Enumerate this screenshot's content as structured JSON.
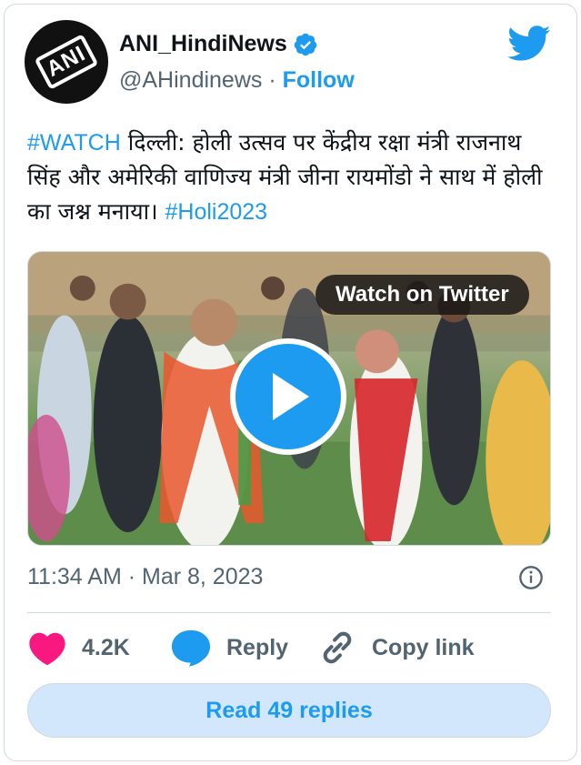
{
  "author": {
    "display_name": "ANI_HindiNews",
    "handle": "@AHindinews",
    "separator": "·",
    "follow_label": "Follow",
    "avatar_text": "ANI",
    "verified": true
  },
  "tweet": {
    "hashtag_watch": "#WATCH",
    "body": "  दिल्ली: होली उत्सव पर केंद्रीय रक्षा मंत्री राजनाथ सिंह और अमेरिकी वाणिज्य मंत्री जीना रायमोंडो ने साथ में होली का जश्न मनाया। ",
    "hashtag_holi": "#Holi2023"
  },
  "media": {
    "watch_label": "Watch on Twitter"
  },
  "meta": {
    "timestamp": "11:34 AM · Mar 8, 2023"
  },
  "actions": {
    "likes_count": "4.2K",
    "reply_label": "Reply",
    "copy_link_label": "Copy link"
  },
  "footer": {
    "read_replies_label": "Read 49 replies"
  },
  "colors": {
    "accent": "#1d9bf0",
    "like": "#f91880",
    "muted_text": "#536471",
    "border": "#cfd9de",
    "button_bg": "#d2e7fb"
  },
  "icons": [
    "verified-badge-icon",
    "twitter-bird-icon",
    "play-icon",
    "info-icon",
    "heart-icon",
    "reply-bubble-icon",
    "link-icon"
  ]
}
